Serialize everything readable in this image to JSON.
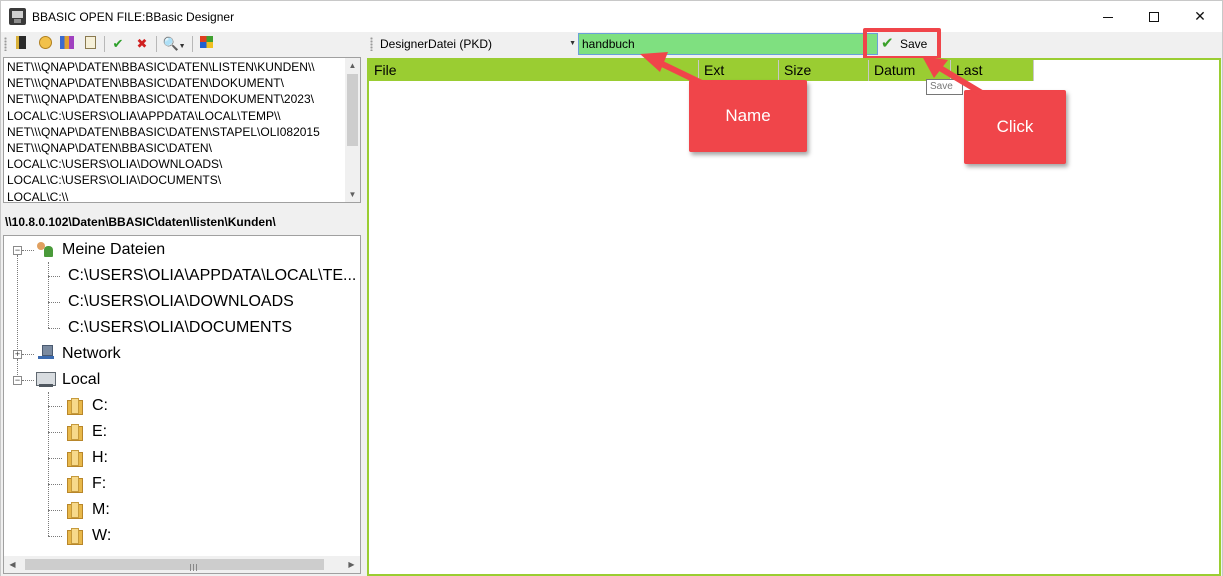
{
  "window": {
    "title": "BBASIC OPEN FILE:BBasic Designer"
  },
  "recent_list": [
    "NET\\\\\\QNAP\\DATEN\\BBASIC\\DATEN\\LISTEN\\KUNDEN\\\\",
    "NET\\\\\\QNAP\\DATEN\\BBASIC\\DATEN\\DOKUMENT\\",
    "NET\\\\\\QNAP\\DATEN\\BBASIC\\DATEN\\DOKUMENT\\2023\\",
    "LOCAL\\C:\\USERS\\OLIA\\APPDATA\\LOCAL\\TEMP\\\\",
    "NET\\\\\\QNAP\\DATEN\\BBASIC\\DATEN\\STAPEL\\OLI082015",
    "NET\\\\\\QNAP\\DATEN\\BBASIC\\DATEN\\",
    "LOCAL\\C:\\USERS\\OLIA\\DOWNLOADS\\",
    "LOCAL\\C:\\USERS\\OLIA\\DOCUMENTS\\",
    "LOCAL\\C:\\\\"
  ],
  "current_path": "\\\\10.8.0.102\\Daten\\BBASIC\\daten\\listen\\Kunden\\",
  "tree": {
    "meine_dateien": "Meine Dateien",
    "meine_children": [
      "C:\\USERS\\OLIA\\APPDATA\\LOCAL\\TE...",
      "C:\\USERS\\OLIA\\DOWNLOADS",
      "C:\\USERS\\OLIA\\DOCUMENTS"
    ],
    "network": "Network",
    "local": "Local",
    "drives": [
      "C:",
      "E:",
      "H:",
      "F:",
      "M:",
      "W:"
    ]
  },
  "file_type": {
    "selected": "DesignerDatei (PKD)"
  },
  "name_field": {
    "value": "handbuch"
  },
  "save_button": {
    "label": "Save",
    "tooltip": "Save"
  },
  "columns": [
    "File",
    "Ext",
    "Size",
    "Datum",
    "Last"
  ],
  "annotations": {
    "name": "Name",
    "click": "Click"
  },
  "colors": {
    "header_green": "#9acd32",
    "input_green": "#7fe080",
    "annotation_red": "#f0454a"
  }
}
